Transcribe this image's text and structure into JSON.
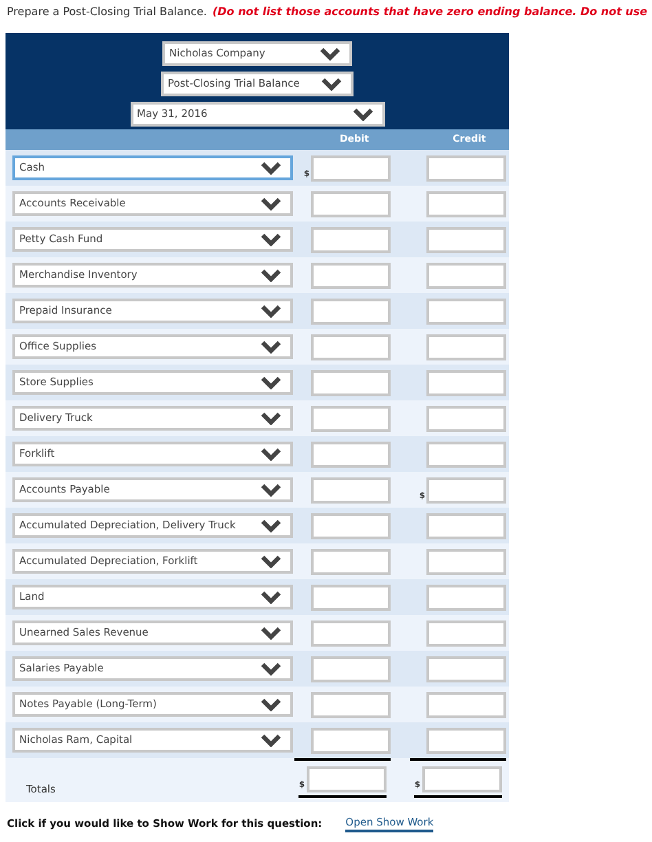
{
  "instruction": {
    "text": "Prepare a Post-Closing Trial Balance.",
    "note": "(Do not list those accounts that have zero ending balance. Do not use"
  },
  "header": {
    "selects": [
      "Nicholas Company",
      "Post-Closing Trial Balance",
      "May 31, 2016"
    ]
  },
  "columns": [
    "Debit",
    "Credit"
  ],
  "rows": [
    {
      "account": "Cash",
      "focused": true,
      "debit_prefix": "$"
    },
    {
      "account": "Accounts Receivable",
      "focused": false
    },
    {
      "account": "Petty Cash Fund",
      "focused": false
    },
    {
      "account": "Merchandise Inventory",
      "focused": false
    },
    {
      "account": "Prepaid Insurance",
      "focused": false
    },
    {
      "account": "Office Supplies",
      "focused": false
    },
    {
      "account": "Store Supplies",
      "focused": false
    },
    {
      "account": "Delivery Truck",
      "focused": false
    },
    {
      "account": "Forklift",
      "focused": false
    },
    {
      "account": "Accounts Payable",
      "focused": false,
      "credit_prefix": "$"
    },
    {
      "account": "Accumulated Depreciation, Delivery Truck",
      "focused": false
    },
    {
      "account": "Accumulated Depreciation, Forklift",
      "focused": false
    },
    {
      "account": "Land",
      "focused": false
    },
    {
      "account": "Unearned Sales Revenue",
      "focused": false
    },
    {
      "account": "Salaries Payable",
      "focused": false
    },
    {
      "account": "Notes Payable (Long-Term)",
      "focused": false
    },
    {
      "account": "Nicholas Ram, Capital",
      "focused": false
    }
  ],
  "totals": {
    "label": "Totals",
    "debit_prefix": "$",
    "credit_prefix": "$"
  },
  "footer": {
    "text": "Click if you would like to Show Work for this question:",
    "link": "Open Show Work"
  }
}
